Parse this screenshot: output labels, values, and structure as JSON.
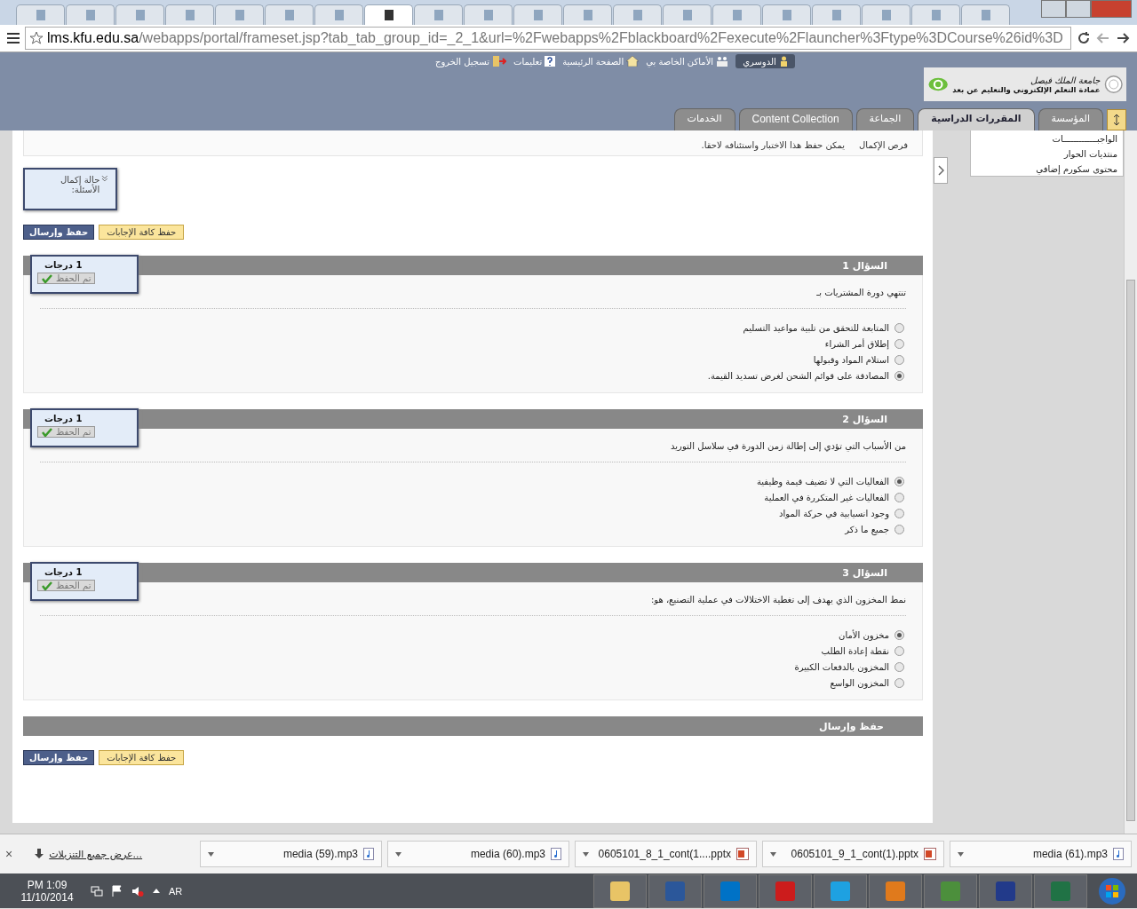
{
  "browser": {
    "tabs": [
      {
        "selected": false
      },
      {
        "selected": false
      },
      {
        "selected": false
      },
      {
        "selected": false
      },
      {
        "selected": false
      },
      {
        "selected": false
      },
      {
        "selected": false
      },
      {
        "selected": true
      },
      {
        "selected": false
      },
      {
        "selected": false
      },
      {
        "selected": false
      },
      {
        "selected": false
      },
      {
        "selected": false
      },
      {
        "selected": false
      },
      {
        "selected": false
      },
      {
        "selected": false
      },
      {
        "selected": false
      },
      {
        "selected": false
      },
      {
        "selected": false
      },
      {
        "selected": false
      }
    ],
    "address": {
      "host": "lms.kfu.edu.sa",
      "path": "/webapps/portal/frameset.jsp?tab_tab_group_id=_2_1&url=%2Fwebapps%2Fblackboard%2Fexecute%2Flauncher%3Ftype%3DCourse%26id%3D"
    }
  },
  "header": {
    "user": "الدوسري",
    "links": [
      "الأماكن الخاصة بي",
      "الصفحة الرئيسية",
      "تعليمات",
      "تسجيل الخروج"
    ],
    "logo": {
      "title": "جامعة الملك فيصل",
      "subtitle": "عمادة التعلم الإلكتروني والتعليم عن بعد"
    },
    "tabs": [
      {
        "label": "المؤسسة",
        "selected": false
      },
      {
        "label": "المقررات الدراسية",
        "selected": true
      },
      {
        "label": "الجماعة",
        "selected": false
      },
      {
        "label": "Content Collection",
        "selected": false
      },
      {
        "label": "الخدمات",
        "selected": false
      }
    ]
  },
  "sidebar": {
    "items": [
      "الواجبـــــــــــــات",
      "منتديات الحوار",
      "محتوى سكورم إضافي"
    ]
  },
  "instructions": {
    "label": "فرص الإكمال",
    "text": "يمكن حفظ هذا الاختبار واستئنافه لاحقا."
  },
  "completion_status": {
    "label": "حالة إكمال الأسئلة:",
    "expanded": false
  },
  "top_buttons": {
    "submit": "حفظ وإرسال",
    "save_all": "حفظ كافة الإجابات"
  },
  "questions": [
    {
      "title": "السؤال 1",
      "points": "1 درجات",
      "saved": "تم الحفظ",
      "text": "تنتهي دورة المشتريات بـ",
      "options": [
        {
          "label": "المتابعة للتحقق من تلبية مواعيد التسليم",
          "selected": false
        },
        {
          "label": "إطلاق أمر الشراء",
          "selected": false
        },
        {
          "label": "استلام المواد وقبولها",
          "selected": false
        },
        {
          "label": "المصادقة على قوائم الشحن لغرض تسديد القيمة.",
          "selected": true
        }
      ]
    },
    {
      "title": "السؤال 2",
      "points": "1 درجات",
      "saved": "تم الحفظ",
      "text": "من الأسباب التي تؤدي إلى إطالة زمن الدورة في سلاسل التوريد",
      "options": [
        {
          "label": "الفعاليات التي لا تضيف قيمة وظيفية",
          "selected": true
        },
        {
          "label": "الفعاليات غير المتكررة في العملية",
          "selected": false
        },
        {
          "label": "وجود انسيابية في حركة المواد",
          "selected": false
        },
        {
          "label": "جميع ما ذكر",
          "selected": false
        }
      ]
    },
    {
      "title": "السؤال 3",
      "points": "1 درجات",
      "saved": "تم الحفظ",
      "text": "نمط المخزون الذي يهدف إلى تغطية الاختلالات في عملية التصنيع، هو:",
      "options": [
        {
          "label": "مخزون الأمان",
          "selected": true
        },
        {
          "label": "نقطة إعادة الطلب",
          "selected": false
        },
        {
          "label": "المخزون بالدفعات الكبيرة",
          "selected": false
        },
        {
          "label": "المخزون الواسع",
          "selected": false
        }
      ]
    }
  ],
  "footer_bar": "حفظ وإرسال",
  "bottom_buttons": {
    "submit": "حفظ وإرسال",
    "save_all": "حفظ كافة الإجابات"
  },
  "downloads": {
    "close": "×",
    "show_all": "عرض جميع التنزيلات...",
    "items": [
      {
        "name": "media (61).mp3",
        "kind": "audio"
      },
      {
        "name": "0605101_9_1_cont(1).pptx",
        "kind": "slides"
      },
      {
        "name": "0605101_8_1_cont(1....pptx",
        "kind": "slides"
      },
      {
        "name": "media (60).mp3",
        "kind": "audio"
      },
      {
        "name": "media (59).mp3",
        "kind": "audio"
      }
    ]
  },
  "taskbar": {
    "time": "PM 1:09",
    "date": "11/10/2014",
    "language": "AR"
  }
}
